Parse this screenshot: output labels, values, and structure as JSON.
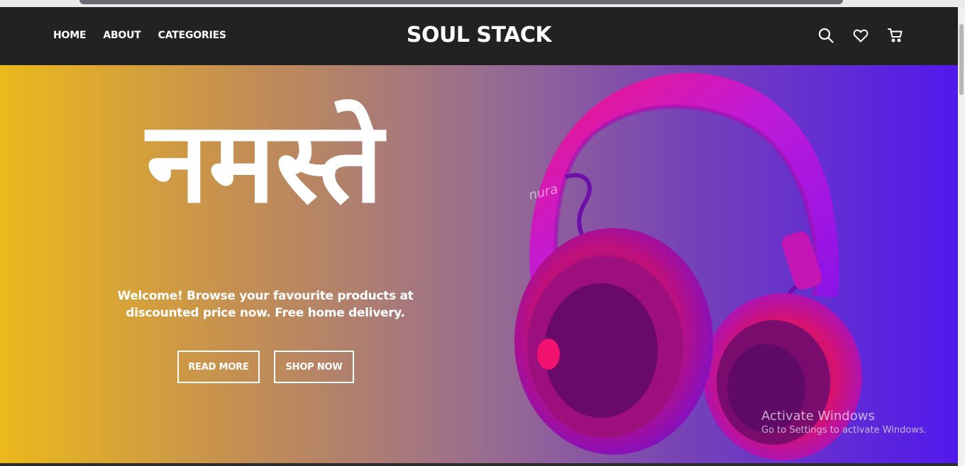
{
  "nav": {
    "links": [
      "HOME",
      "ABOUT",
      "CATEGORIES"
    ],
    "brand": "SOUL STACK",
    "icons": [
      "search-icon",
      "heart-icon",
      "cart-icon"
    ]
  },
  "hero": {
    "headline": "नमस्ते",
    "subtext": "Welcome! Browse your favourite products at discounted price now. Free home delivery.",
    "buttons": {
      "read_more": "READ MORE",
      "shop_now": "SHOP NOW"
    },
    "image_label": "nura",
    "gradient": [
      "#ebb91c",
      "#c48f52",
      "#9a6e8e",
      "#7642b7",
      "#5119ec"
    ]
  },
  "watermark": {
    "title": "Activate Windows",
    "subtitle": "Go to Settings to activate Windows."
  },
  "colors": {
    "navbar": "#222222",
    "text": "#ffffff",
    "headphone_pink": "#f0126e",
    "headphone_purple": "#8a12e8"
  }
}
